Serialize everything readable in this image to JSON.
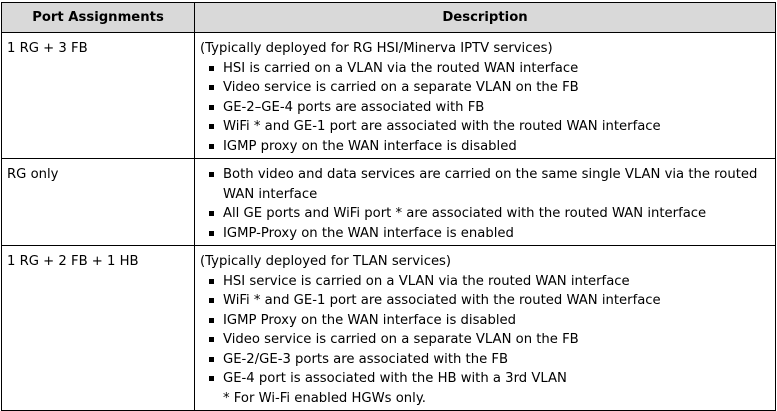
{
  "table": {
    "headers": {
      "port": "Port Assignments",
      "description": "Description"
    },
    "rows": [
      {
        "port": "1 RG + 3 FB",
        "intro": "(Typically deployed for RG HSI/Minerva IPTV services)",
        "bullets": [
          "HSI is carried on a VLAN via the routed WAN interface",
          "Video service is carried on a separate VLAN on the FB",
          "GE-2–GE-4 ports are associated with FB",
          "WiFi * and GE-1 port are associated with the routed WAN interface",
          "IGMP proxy on the WAN interface is disabled"
        ]
      },
      {
        "port": "RG only",
        "bullets": [
          "Both video and data services are carried on the same single VLAN via the routed WAN interface",
          "All GE ports and WiFi port * are associated with the routed WAN interface",
          "IGMP-Proxy on the WAN interface is enabled"
        ]
      },
      {
        "port": "1 RG + 2 FB + 1 HB",
        "intro": "(Typically deployed for TLAN services)",
        "bullets": [
          "HSI service is carried on a VLAN via the routed WAN interface",
          "WiFi * and GE-1 port are associated with the routed WAN interface",
          "IGMP Proxy on the WAN interface is disabled",
          "Video service is carried on a separate VLAN on the FB",
          "GE-2/GE-3 ports are associated with the FB",
          "GE-4 port is associated with the HB with a 3rd VLAN"
        ],
        "note": "* For Wi-Fi enabled HGWs only."
      }
    ]
  }
}
